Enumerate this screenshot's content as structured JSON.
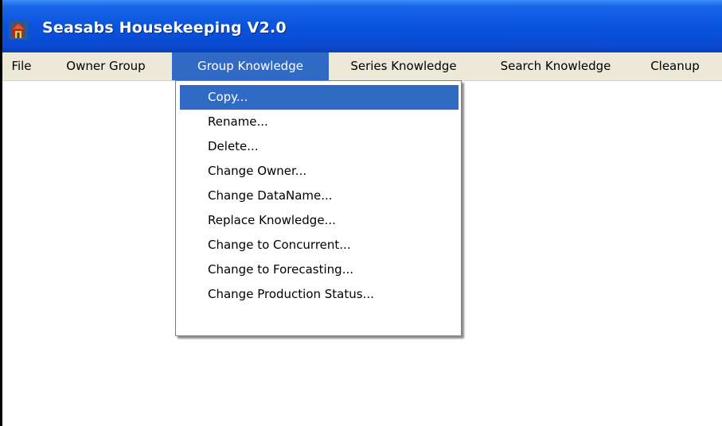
{
  "window": {
    "title": "Seasabs Housekeeping V2.0",
    "app_icon": "house-icon"
  },
  "menubar": {
    "items": [
      {
        "label": "File"
      },
      {
        "label": "Owner Group"
      },
      {
        "label": "Group Knowledge",
        "active": true
      },
      {
        "label": "Series Knowledge"
      },
      {
        "label": "Search Knowledge"
      },
      {
        "label": "Cleanup"
      }
    ]
  },
  "dropdown": {
    "items": [
      {
        "label": "Copy...",
        "selected": true
      },
      {
        "label": "Rename..."
      },
      {
        "label": "Delete..."
      },
      {
        "label": "Change Owner..."
      },
      {
        "label": "Change DataName..."
      },
      {
        "label": "Replace Knowledge..."
      },
      {
        "label": "Change to Concurrent..."
      },
      {
        "label": "Change to Forecasting..."
      },
      {
        "label": "Change Production Status..."
      }
    ]
  },
  "colors": {
    "title_bar": "#0a53dd",
    "menu_bar": "#ece9d8",
    "highlight": "#316ac5"
  }
}
